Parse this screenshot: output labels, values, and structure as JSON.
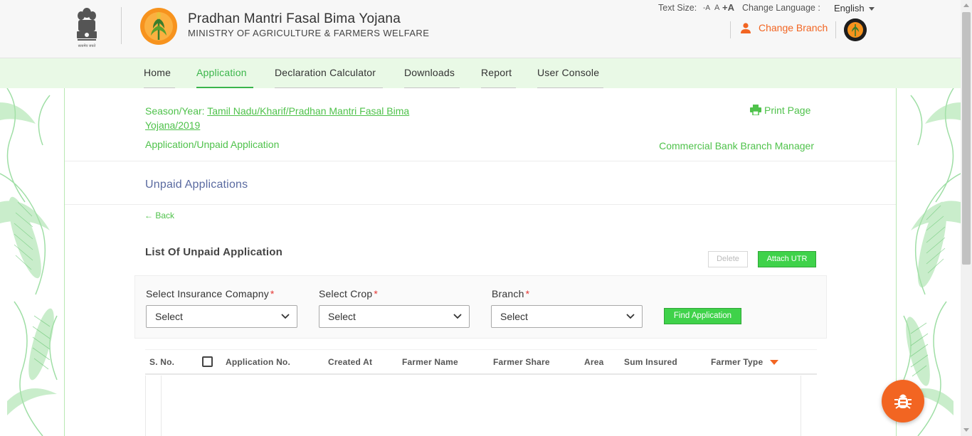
{
  "header": {
    "title": "Pradhan Mantri Fasal Bima Yojana",
    "subtitle": "MINISTRY OF AGRICULTURE & FARMERS WELFARE",
    "emblem_caption": "सत्यमेव जयते",
    "text_size_label": "Text Size:",
    "text_size_small": "-A",
    "text_size_normal": "A",
    "text_size_large": "+A",
    "language_label": "Change Language :",
    "language_value": "English",
    "change_branch_label": "Change Branch"
  },
  "nav": {
    "items": [
      {
        "label": "Home"
      },
      {
        "label": "Application"
      },
      {
        "label": "Declaration Calculator"
      },
      {
        "label": "Downloads"
      },
      {
        "label": "Report"
      },
      {
        "label": "User Console"
      }
    ],
    "active": "Application"
  },
  "page": {
    "season_prefix": "Season/Year: ",
    "season_value": "Tamil Nadu/Kharif/Pradhan Mantri Fasal Bima Yojana/2019",
    "print_label": "Print Page",
    "breadcrumb": "Application/Unpaid Application",
    "role": "Commercial Bank Branch Manager",
    "section_title": "Unpaid Applications",
    "back_label": "← Back",
    "list_title": "List Of Unpaid Application",
    "delete_label": "Delete",
    "attach_utr_label": "Attach UTR"
  },
  "filters": {
    "insurance_label": "Select Insurance Comapny",
    "insurance_value": "Select",
    "crop_label": "Select Crop",
    "crop_value": "Select",
    "branch_label": "Branch",
    "branch_value": "Select",
    "required_mark": "*",
    "find_label": "Find Application"
  },
  "table": {
    "columns": [
      "S. No.",
      "Application No.",
      "Created At",
      "Farmer Name",
      "Farmer Share",
      "Area",
      "Sum Insured",
      "Farmer Type"
    ],
    "rows": []
  },
  "colors": {
    "accent_green": "#3ab54a",
    "accent_orange": "#f26522",
    "nav_bg": "#e9f9e6"
  }
}
